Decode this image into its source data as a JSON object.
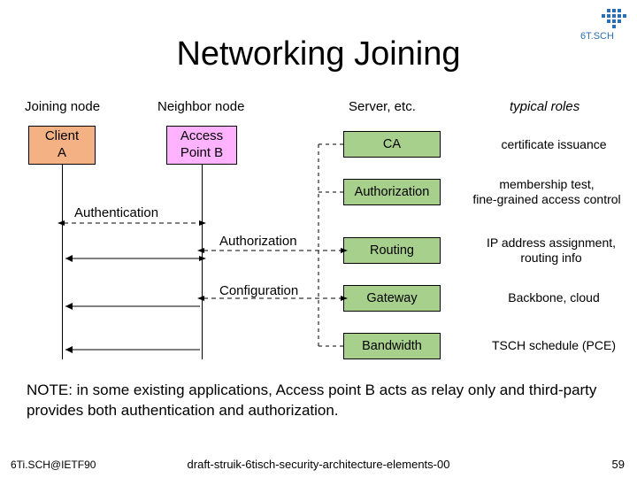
{
  "title": "Networking Joining",
  "headers": {
    "joining": "Joining node",
    "neighbor": "Neighbor node",
    "server": "Server, etc.",
    "roles": "typical roles"
  },
  "nodes": {
    "client": "Client\nA",
    "ap": "Access\nPoint B"
  },
  "servers": {
    "ca": "CA",
    "authorization": "Authorization",
    "routing": "Routing",
    "gateway": "Gateway",
    "bandwidth": "Bandwidth"
  },
  "roles": {
    "ca": "certificate issuance",
    "authorization": "membership test,\nfine-grained access control",
    "routing": "IP address assignment,\nrouting info",
    "gateway": "Backbone, cloud",
    "bandwidth": "TSCH schedule (PCE)"
  },
  "messages": {
    "authentication": "Authentication",
    "authorization": "Authorization",
    "configuration": "Configuration"
  },
  "note": "NOTE: in some existing applications, Access point B acts as relay only and third-party provides both authentication and authorization.",
  "footer": {
    "left": "6Ti.SCH@IETF90",
    "center": "draft-struik-6tisch-security-architecture-elements-00",
    "pageno": "59"
  }
}
